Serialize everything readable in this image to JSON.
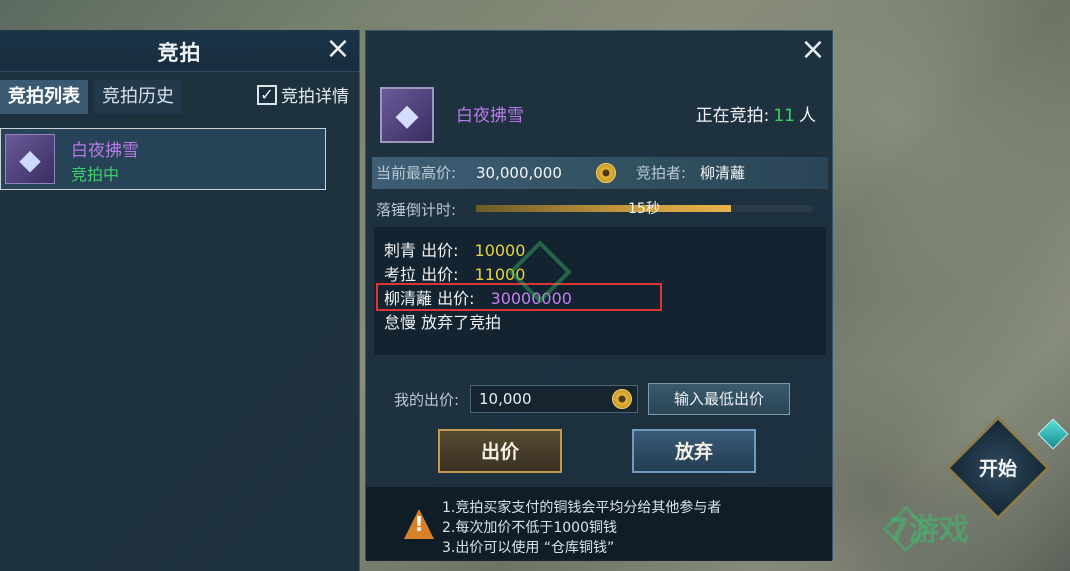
{
  "left_panel": {
    "title": "竞拍",
    "tabs": [
      {
        "label": "竞拍列表",
        "active": true
      },
      {
        "label": "竞拍历史",
        "active": false
      }
    ],
    "detail_checkbox": {
      "label": "竞拍详情",
      "checked": true
    },
    "item": {
      "name": "白夜拂雪",
      "status": "竞拍中"
    }
  },
  "right_panel": {
    "item_name": "白夜拂雪",
    "bidding_label": "正在竞拍:",
    "bidding_count": "11",
    "bidding_unit": "人",
    "current_price_label": "当前最高价:",
    "current_price": "30,000,000",
    "bidder_label": "竞拍者:",
    "bidder": "柳清蘺",
    "countdown_label": "落锤倒计时:",
    "countdown_text": "15秒",
    "countdown_progress": 0.76,
    "log": [
      {
        "name": "刺青",
        "action": "出价:",
        "value": "10000"
      },
      {
        "name": "考拉",
        "action": "出价:",
        "value": "11000"
      },
      {
        "name": "柳清蘺",
        "action": "出价:",
        "value": "30000000"
      },
      {
        "name": "怠慢",
        "action": "放弃了竞拍",
        "value": ""
      }
    ],
    "my_bid_label": "我的出价:",
    "my_bid_value": "10,000",
    "min_bid_button": "输入最低出价",
    "bid_button": "出价",
    "abandon_button": "放弃",
    "tips": [
      "1.竞拍买家支付的铜钱会平均分给其他参与者",
      "2.每次加价不低于1000铜钱",
      "3.出价可以使用 “仓库铜钱”"
    ]
  },
  "start_button": "开始",
  "watermark": "7游戏",
  "colors": {
    "item_purple": "#b77ae8",
    "status_green": "#3fcf6a",
    "highlight_red": "#e03535",
    "bid_yellow": "#e5d240"
  },
  "icons": [
    "close-icon",
    "checkbox-checked-icon",
    "item-icon",
    "coin-icon",
    "warning-icon",
    "gem-icon"
  ]
}
